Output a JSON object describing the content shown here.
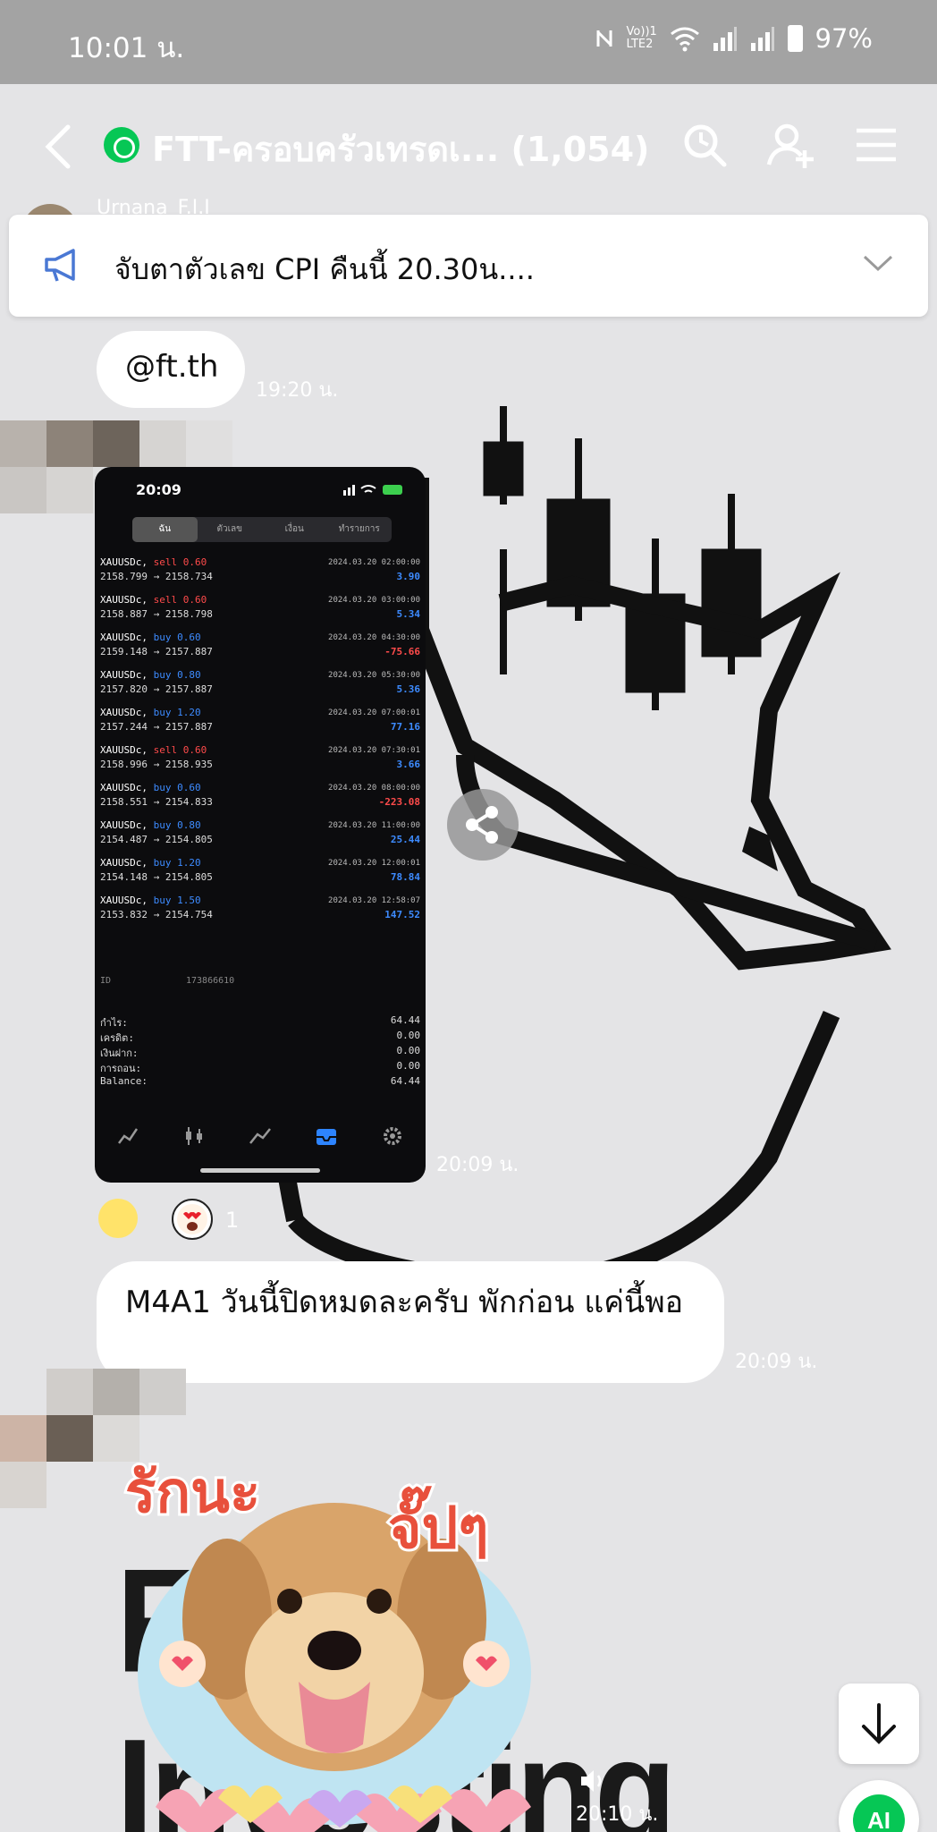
{
  "status_bar": {
    "time": "10:01 น.",
    "network": "Vo))1 LTE2",
    "battery": "97%"
  },
  "header": {
    "title": "FTT-ครอบครัวเทรดเ... (1,054)"
  },
  "announcement": {
    "text": "จับตาตัวเลข CPI คืนนี้ 20.30น...."
  },
  "peek_sender": "Urnana_F.I.I",
  "messages": {
    "m1": {
      "text": "@ft.th",
      "time": "19:20 น."
    },
    "m2": {
      "time": "20:09 น."
    },
    "m3": {
      "text": "M4A1 วันนี้ปิดหมดละครับ พักก่อน แค่นี้พอ",
      "time": "20:09 น."
    },
    "m4": {
      "time": "20:10 น."
    }
  },
  "reactions": {
    "count": "1"
  },
  "wallpaper_text": "FTT Investing",
  "screenshot": {
    "time": "20:09",
    "tabs": [
      "ฉัน",
      "ตัวเลข",
      "เงื่อน",
      "ทำรายการ"
    ],
    "trades": [
      {
        "symbol": "XAUUSDc,",
        "side": "sell 0.60",
        "dir": "sell",
        "prices": "2158.799 → 2158.734",
        "datetime": "2024.03.20 02:00:00",
        "pl": "3.90",
        "sign": "pos"
      },
      {
        "symbol": "XAUUSDc,",
        "side": "sell 0.60",
        "dir": "sell",
        "prices": "2158.887 → 2158.798",
        "datetime": "2024.03.20 03:00:00",
        "pl": "5.34",
        "sign": "pos"
      },
      {
        "symbol": "XAUUSDc,",
        "side": "buy 0.60",
        "dir": "buy",
        "prices": "2159.148 → 2157.887",
        "datetime": "2024.03.20 04:30:00",
        "pl": "-75.66",
        "sign": "neg"
      },
      {
        "symbol": "XAUUSDc,",
        "side": "buy 0.80",
        "dir": "buy",
        "prices": "2157.820 → 2157.887",
        "datetime": "2024.03.20 05:30:00",
        "pl": "5.36",
        "sign": "pos"
      },
      {
        "symbol": "XAUUSDc,",
        "side": "buy 1.20",
        "dir": "buy",
        "prices": "2157.244 → 2157.887",
        "datetime": "2024.03.20 07:00:01",
        "pl": "77.16",
        "sign": "pos"
      },
      {
        "symbol": "XAUUSDc,",
        "side": "sell 0.60",
        "dir": "sell",
        "prices": "2158.996 → 2158.935",
        "datetime": "2024.03.20 07:30:01",
        "pl": "3.66",
        "sign": "pos"
      },
      {
        "symbol": "XAUUSDc,",
        "side": "buy 0.60",
        "dir": "buy",
        "prices": "2158.551 → 2154.833",
        "datetime": "2024.03.20 08:00:00",
        "pl": "-223.08",
        "sign": "neg"
      },
      {
        "symbol": "XAUUSDc,",
        "side": "buy 0.80",
        "dir": "buy",
        "prices": "2154.487 → 2154.805",
        "datetime": "2024.03.20 11:00:00",
        "pl": "25.44",
        "sign": "pos"
      },
      {
        "symbol": "XAUUSDc,",
        "side": "buy 1.20",
        "dir": "buy",
        "prices": "2154.148 → 2154.805",
        "datetime": "2024.03.20 12:00:01",
        "pl": "78.84",
        "sign": "pos"
      },
      {
        "symbol": "XAUUSDc,",
        "side": "buy 1.50",
        "dir": "buy",
        "prices": "2153.832 → 2154.754",
        "datetime": "2024.03.20 12:58:07",
        "pl": "147.52",
        "sign": "pos"
      }
    ],
    "detail_id": "173866610",
    "summary": [
      {
        "k": "กำไร:",
        "v": "64.44"
      },
      {
        "k": "เครดิต:",
        "v": "0.00"
      },
      {
        "k": "เงินฝาก:",
        "v": "0.00"
      },
      {
        "k": "การถอน:",
        "v": "0.00"
      },
      {
        "k": "Balance:",
        "v": "64.44"
      }
    ]
  },
  "colors": {
    "line_green": "#06c755",
    "background": "#e4e4e6",
    "bubble": "#ffffff"
  }
}
